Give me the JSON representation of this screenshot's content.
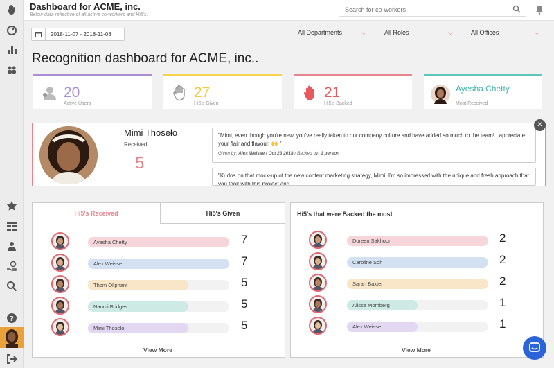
{
  "header": {
    "title": "Dashboard for ACME, inc.",
    "subtitle": "Below data reflective of all active co-workers and Hi5's.",
    "search_placeholder": "Search for co-workers"
  },
  "filters": {
    "date_range": "2018-11-07 - 2018-11-08",
    "departments": "All Departments",
    "roles": "All Roles",
    "offices": "All Offices"
  },
  "page_title": "Recognition dashboard for ACME, inc..",
  "stats": [
    {
      "value": "20",
      "label": "Active Users",
      "color": "#a98fd3",
      "icon": "users-icon"
    },
    {
      "value": "27",
      "label": "Hi5's Given",
      "color": "#f5d34c",
      "icon": "hand-outline-icon"
    },
    {
      "value": "21",
      "label": "Hi5's Backed",
      "color": "#e8858c",
      "icon": "hand-red-icon"
    },
    {
      "name": "Ayesha Chetty",
      "label": "Most Received",
      "color": "#5cc7b9",
      "icon": "avatar"
    }
  ],
  "spotlight": {
    "name": "Mimi Thoseło",
    "received_label": "Received:",
    "received_count": "5",
    "quotes": [
      {
        "text": "\"Mimi, even though you're new, you've really taken to our company culture and have added so much to the team! I appreciate your flair and flavour. 🙌 \"",
        "given_by_label": "Given by:",
        "given_by": "Alex Weisse / Oct 23 2018",
        "backed_by_label": "/ Backed by:",
        "backed_by": "1 person"
      },
      {
        "text": "\"Kudos on that mock-up of the new content marketing strategy, Mimi. I'm so impressed with the unique and fresh approach that you took with this project and..."
      }
    ]
  },
  "received_panel": {
    "tab_received": "Hi5's Received",
    "tab_given": "Hi5's Given",
    "rows": [
      {
        "name": "Ayesha Chetty",
        "count": 7,
        "fraction": 1.0,
        "color": "#f6d6da"
      },
      {
        "name": "Alex Weisse",
        "count": 7,
        "fraction": 1.0,
        "color": "#d3e1f3"
      },
      {
        "name": "Thom Oliphant",
        "count": 5,
        "fraction": 0.71,
        "color": "#f9e6c8"
      },
      {
        "name": "Naomi Bridges",
        "count": 5,
        "fraction": 0.71,
        "color": "#cdeae4"
      },
      {
        "name": "Mimi Thoselo",
        "count": 5,
        "fraction": 0.71,
        "color": "#e2d8f1"
      }
    ],
    "view_more": "View More"
  },
  "backed_panel": {
    "title": "Hi5's that were Backed the most",
    "rows": [
      {
        "name": "Doreen Sakhoor",
        "count": 2,
        "fraction": 1.0,
        "color": "#f6d6da"
      },
      {
        "name": "Caroline Soh",
        "count": 2,
        "fraction": 1.0,
        "color": "#d3e1f3"
      },
      {
        "name": "Sarah Baxter",
        "count": 2,
        "fraction": 1.0,
        "color": "#f9e6c8"
      },
      {
        "name": "Alissa Momberg",
        "count": 1,
        "fraction": 0.5,
        "color": "#cdeae4"
      },
      {
        "name": "Alex Weisse",
        "count": 1,
        "fraction": 0.5,
        "color": "#e2d8f1"
      }
    ],
    "view_more": "View More"
  }
}
